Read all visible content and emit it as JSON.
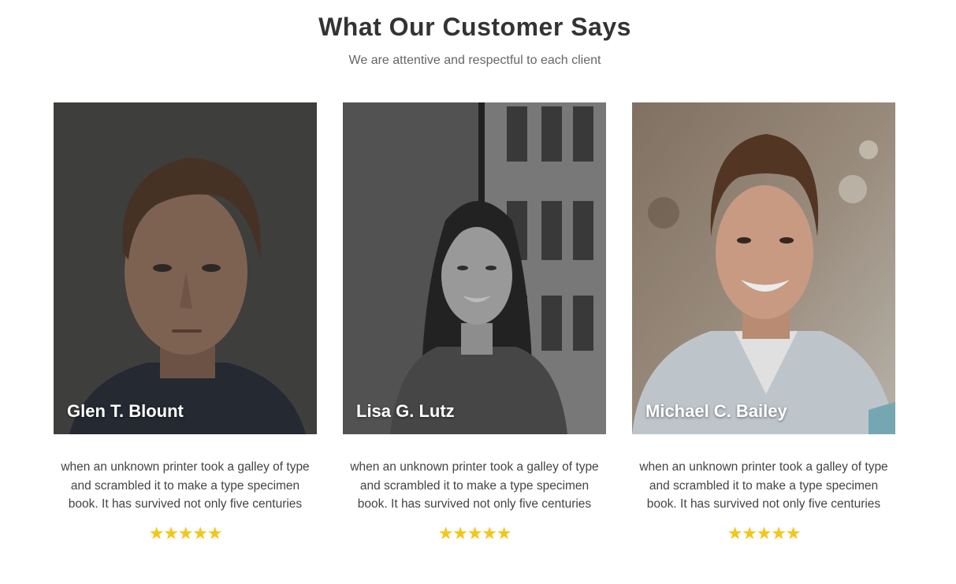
{
  "section": {
    "title": "What Our Customer Says",
    "subtitle": "We are attentive and respectful to each client"
  },
  "colors": {
    "heading": "#333333",
    "subtitle": "#666666",
    "star": "#f5c518",
    "name_text": "#ffffff"
  },
  "testimonials": [
    {
      "name": "Glen T. Blount",
      "photo": "man-portrait-dark-background",
      "quote": "when an unknown printer took a galley of type and scrambled it to make a type specimen book. It has survived not only five centuries",
      "rating": 5
    },
    {
      "name": "Lisa G. Lutz",
      "photo": "woman-portrait-grayscale-window",
      "quote": "when an unknown printer took a galley of type and scrambled it to make a type specimen book. It has survived not only five centuries",
      "rating": 5
    },
    {
      "name": "Michael C. Bailey",
      "photo": "man-portrait-smiling-blazer",
      "quote": "when an unknown printer took a galley of type and scrambled it to make a type specimen book. It has survived not only five centuries",
      "rating": 5
    }
  ]
}
